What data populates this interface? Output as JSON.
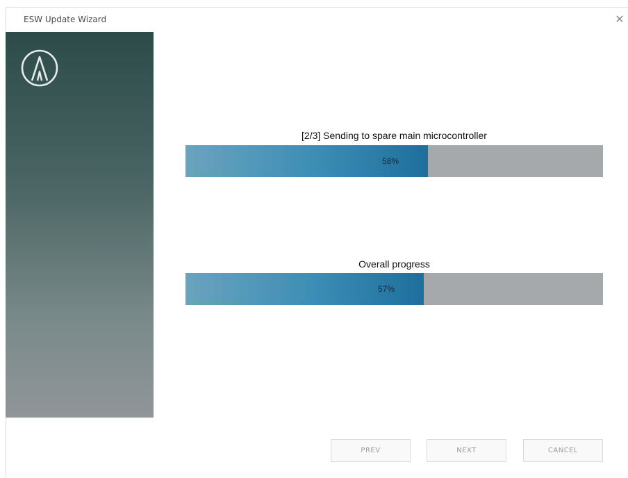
{
  "window": {
    "title": "ESW Update Wizard",
    "close_glyph": "✕"
  },
  "side_panel": {
    "logo_icon": "audio-technica-logo-icon"
  },
  "task_progress": {
    "label": "[2/3] Sending to spare main microcontroller",
    "percent": 58,
    "text": "58%"
  },
  "overall_progress": {
    "label": "Overall progress",
    "percent": 57,
    "text": "57%"
  },
  "buttons": {
    "prev": "PREV",
    "next": "NEXT",
    "cancel": "CANCEL"
  },
  "colors": {
    "side_panel_top": "#2c4b49",
    "side_panel_bottom": "#909598",
    "progress_fill": "#2f86b0",
    "progress_track": "#a6a9ac"
  }
}
